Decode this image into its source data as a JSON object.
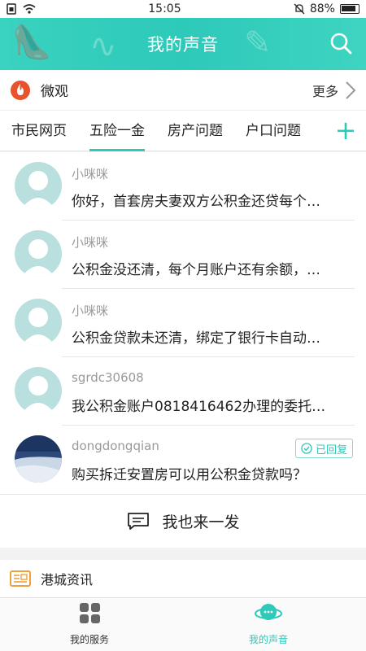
{
  "status_bar": {
    "time": "15:05",
    "battery": "88%"
  },
  "header": {
    "title": "我的声音"
  },
  "weiguan": {
    "title": "微观",
    "more_label": "更多"
  },
  "tabs": [
    {
      "label": "市民网页",
      "active": false
    },
    {
      "label": "五险一金",
      "active": true
    },
    {
      "label": "房产问题",
      "active": false
    },
    {
      "label": "户口问题",
      "active": false
    }
  ],
  "posts": [
    {
      "author": "小咪咪",
      "text": "你好，首套房夫妻双方公积金还贷每个…"
    },
    {
      "author": "小咪咪",
      "text": "公积金没还清，每个月账户还有余额，…"
    },
    {
      "author": "小咪咪",
      "text": "公积金贷款未还清，绑定了银行卡自动…"
    },
    {
      "author": "sgrdc30608",
      "text": "我公积金账户0818416462办理的委托…"
    },
    {
      "author": "dongdongqian",
      "text": "购买拆迁安置房可以用公积金贷款吗？",
      "badge": "已回复"
    }
  ],
  "publish": {
    "label": "我也来一发"
  },
  "news": {
    "title": "港城资讯"
  },
  "bottom_nav": [
    {
      "label": "我的服务",
      "active": false
    },
    {
      "label": "我的声音",
      "active": true
    }
  ],
  "colors": {
    "accent": "#2dc9b9",
    "fire": "#e8532e"
  }
}
